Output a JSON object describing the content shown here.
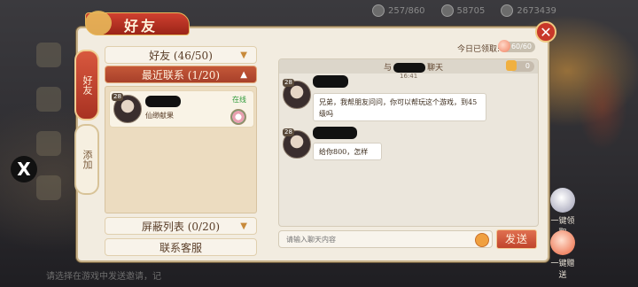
{
  "panel": {
    "title": "好友",
    "close_glyph": "✕"
  },
  "side_tabs": [
    {
      "label": "好友",
      "active": true
    },
    {
      "label": "添加",
      "active": false
    }
  ],
  "groups": {
    "friends": {
      "label": "好友 (46/50)"
    },
    "recent": {
      "label": "最近联系 (1/20)"
    },
    "blocked": {
      "label": "屏蔽列表 (0/20)"
    },
    "support": {
      "label": "联系客服"
    }
  },
  "recent_contact": {
    "level": "28",
    "subtitle": "仙缈献果",
    "status": "在线"
  },
  "chat": {
    "claimed_label": "今日已领取:",
    "claimed_value": "60/60",
    "header_name_prefix": "与",
    "header_name_suffix": "聊天",
    "likes": "0",
    "timestamp": "16:41",
    "messages": [
      {
        "level": "28",
        "text": "兄弟，我帮朋友问问，你可以帮玩这个游戏，到45级吗"
      },
      {
        "level": "28",
        "text": "给你800，怎样"
      }
    ],
    "input_placeholder": "请输入聊天内容",
    "send_label": "发送"
  },
  "background": {
    "currency": [
      {
        "value": "257/860"
      },
      {
        "value": "58705"
      },
      {
        "value": "2673439"
      }
    ],
    "right_buttons": [
      {
        "label": "一键领取"
      },
      {
        "label": "一键赠送"
      }
    ],
    "ticker": "请选择在游戏中发送邀请，记"
  },
  "colors": {
    "accent_red": "#c0442c",
    "online_green": "#2f9a3a",
    "panel_bg": "#f2ece0"
  }
}
